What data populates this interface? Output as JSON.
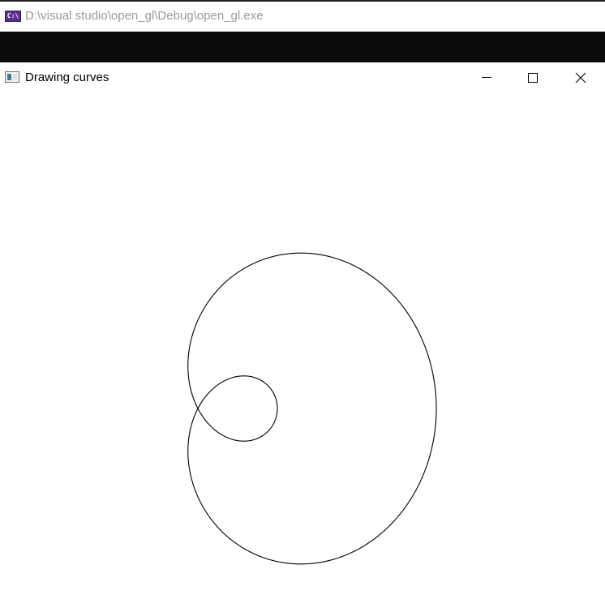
{
  "console_window": {
    "title": "D:\\visual studio\\open_gl\\Debug\\open_gl.exe",
    "icon": "console-app-icon",
    "icon_text": "C:\\"
  },
  "gl_window": {
    "title": "Drawing curves",
    "icon": "window-app-icon",
    "controls": {
      "minimize": "minimize-icon",
      "maximize": "maximize-icon",
      "close": "close-icon"
    }
  },
  "canvas": {
    "background": "#ffffff",
    "stroke": "#000000",
    "curve": "limaçon with inner loop (r = a + b·cosθ)",
    "curve_params": {
      "a": 0.5,
      "b": 1.0
    }
  }
}
